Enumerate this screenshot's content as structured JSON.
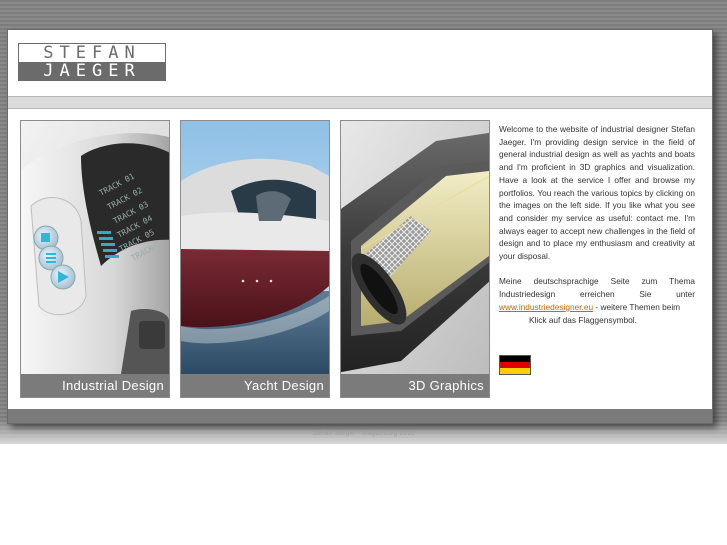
{
  "logo": {
    "line1": "STEFAN",
    "line2": "JAEGER"
  },
  "tiles": [
    {
      "caption": "Industrial Design"
    },
    {
      "caption": "Yacht Design"
    },
    {
      "caption": "3D Graphics"
    }
  ],
  "device_screen_tracks": [
    "TRACK 01",
    "TRACK 02",
    "TRACK 03",
    "TRACK 04",
    "TRACK 05",
    "TRACK"
  ],
  "intro": {
    "paragraph1": "Welcome to the website of industrial designer Stefan Jaeger. I'm providing design service in the field of general industrial design as well as yachts and boats and I'm proficient in 3D graphics and visualization. Have a look at the service I offer and browse my portfolios. You reach the various topics by clicking on the images on the left side. If you like what you see and consider my service as useful: contact me. I'm always eager to accept new challenges in the field of design and to place my enthusiasm and creativity at your disposal.",
    "paragraph2_before": "Meine deutschsprachige Seite zum Thema Industriedesign erreichen Sie unter",
    "paragraph2_link": "www.industriedesigner.eu",
    "paragraph2_after": " - weitere Themen beim",
    "paragraph2_line2": "Klick auf das Flaggensymbol."
  },
  "flag": {
    "icon": "german-flag-icon",
    "colors": [
      "#000000",
      "#dd0000",
      "#ffce00"
    ]
  },
  "footer": {
    "text": "Stefan Jaeger · Magdeburg 2010"
  },
  "colors": {
    "caption_bg": "#7b7b7b",
    "link": "#cc6600",
    "backdrop": "#808080"
  }
}
